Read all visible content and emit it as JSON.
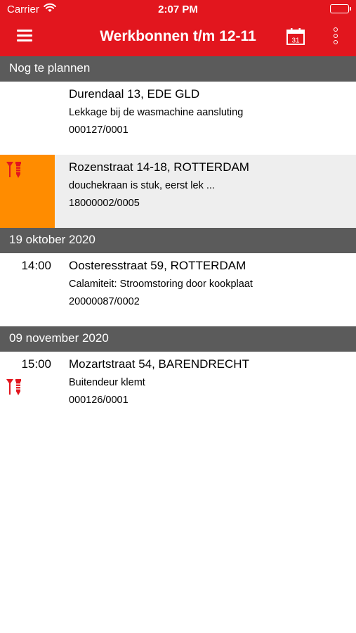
{
  "status_bar": {
    "carrier": "Carrier",
    "time": "2:07 PM"
  },
  "header": {
    "title": "Werkbonnen t/m 12-11",
    "calendar_day": "31"
  },
  "sections": [
    {
      "label": "Nog te plannen"
    },
    {
      "label": "19 oktober 2020"
    },
    {
      "label": "09 november 2020"
    }
  ],
  "orders": [
    {
      "time": "",
      "address": "Durendaal 13, EDE GLD",
      "description": "Lekkage bij de wasmachine aansluting",
      "code": "000127/0001"
    },
    {
      "time": "",
      "address": "Rozenstraat 14-18, ROTTERDAM",
      "description": "douchekraan is stuk, eerst lek  ...",
      "code": "18000002/0005"
    },
    {
      "time": "14:00",
      "address": "Oosteresstraat 59, ROTTERDAM",
      "description": "Calamiteit: Stroomstoring door kookplaat",
      "code": "20000087/0002"
    },
    {
      "time": "15:00",
      "address": "Mozartstraat 54, BARENDRECHT",
      "description": "Buitendeur klemt",
      "code": "000126/0001"
    }
  ],
  "colors": {
    "brand": "#e2161e",
    "section_bg": "#5b5b5b",
    "highlight": "#ff8c00",
    "selected_row": "#eeeeee"
  },
  "icons": {
    "menu": "hamburger-icon",
    "calendar": "calendar-icon",
    "more": "more-vertical-icon",
    "tool": "screw-tools-icon"
  }
}
